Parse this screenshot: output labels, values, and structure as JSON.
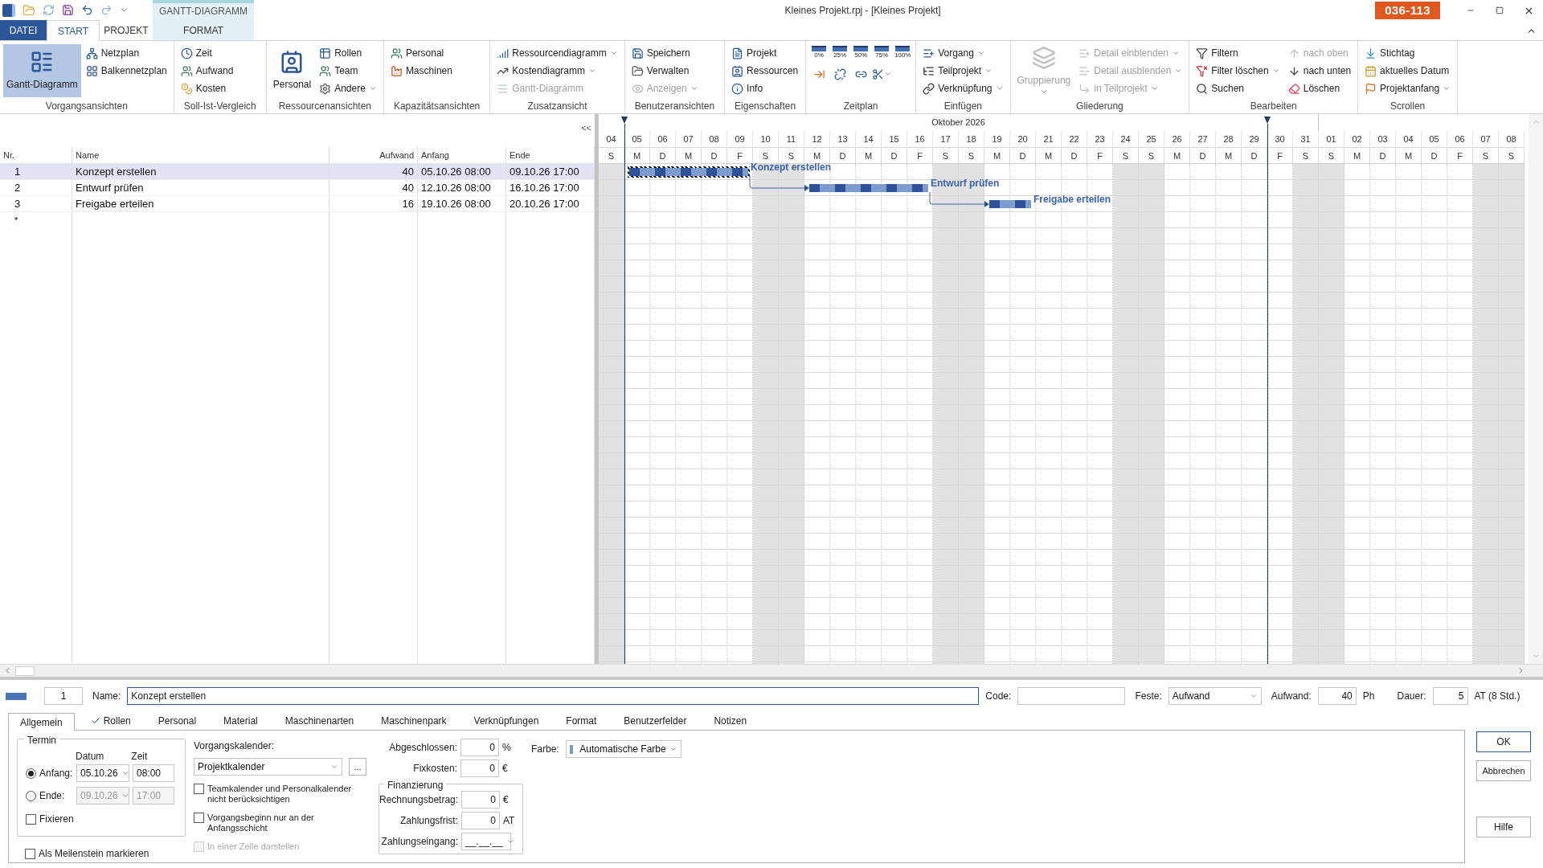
{
  "title_bar": {
    "title": "Kleines Projekt.rpj - [Kleines Projekt]",
    "badge": "036-113",
    "context_tab": "GANTT-DIAGRAMM"
  },
  "ribbon_tabs": [
    {
      "label": "DATEI",
      "kind": "file",
      "selected": false
    },
    {
      "label": "START",
      "kind": "tab",
      "selected": true
    },
    {
      "label": "PROJEKT",
      "kind": "tab",
      "selected": false
    },
    {
      "label": "FORMAT",
      "kind": "context",
      "selected": false
    }
  ],
  "ribbon_groups": [
    {
      "label": "Vorgangsansichten",
      "columns": [
        [
          {
            "label": "Gantt-Diagramm",
            "kind": "large",
            "selected": true,
            "disabled": false,
            "dropdown": false
          }
        ],
        [
          {
            "label": "Netzplan",
            "kind": "small",
            "selected": false,
            "disabled": false,
            "dropdown": false
          },
          {
            "label": "Balkennetzplan",
            "kind": "small",
            "selected": false,
            "disabled": false,
            "dropdown": false
          }
        ]
      ]
    },
    {
      "label": "Soll-Ist-Vergleich",
      "columns": [
        [
          {
            "label": "Zeit",
            "kind": "small",
            "disabled": false,
            "dropdown": false
          },
          {
            "label": "Aufwand",
            "kind": "small",
            "disabled": false,
            "dropdown": false
          },
          {
            "label": "Kosten",
            "kind": "small",
            "disabled": false,
            "dropdown": false
          }
        ]
      ]
    },
    {
      "label": "Ressourcenansichten",
      "columns": [
        [
          {
            "label": "Personal",
            "kind": "large",
            "disabled": false,
            "dropdown": false
          }
        ],
        [
          {
            "label": "Rollen",
            "kind": "small",
            "disabled": false,
            "dropdown": false
          },
          {
            "label": "Team",
            "kind": "small",
            "disabled": false,
            "dropdown": false
          },
          {
            "label": "Andere",
            "kind": "small",
            "disabled": false,
            "dropdown": true
          }
        ]
      ]
    },
    {
      "label": "Kapazitätsansichten",
      "columns": [
        [
          {
            "label": "Personal",
            "kind": "small",
            "disabled": false,
            "dropdown": false
          },
          {
            "label": "Maschinen",
            "kind": "small",
            "disabled": false,
            "dropdown": false
          }
        ]
      ]
    },
    {
      "label": "Zusatzansicht",
      "columns": [
        [
          {
            "label": "Ressourcendiagramm",
            "kind": "small",
            "disabled": false,
            "dropdown": true
          },
          {
            "label": "Kostendiagramm",
            "kind": "small",
            "disabled": false,
            "dropdown": true
          },
          {
            "label": "Gantt-Diagramm",
            "kind": "small",
            "disabled": true,
            "dropdown": false
          }
        ]
      ]
    },
    {
      "label": "Benutzeransichten",
      "columns": [
        [
          {
            "label": "Speichern",
            "kind": "small",
            "disabled": false,
            "dropdown": false
          },
          {
            "label": "Verwalten",
            "kind": "small",
            "disabled": false,
            "dropdown": false
          },
          {
            "label": "Anzeigen",
            "kind": "small",
            "disabled": true,
            "dropdown": true
          }
        ]
      ]
    },
    {
      "label": "Eigenschaften",
      "columns": [
        [
          {
            "label": "Projekt",
            "kind": "small",
            "disabled": false,
            "dropdown": false
          },
          {
            "label": "Ressourcen",
            "kind": "small",
            "disabled": false,
            "dropdown": false
          },
          {
            "label": "Info",
            "kind": "small",
            "disabled": false,
            "dropdown": false
          }
        ]
      ]
    },
    {
      "label": "Zeitplan",
      "columns": [
        [
          {
            "label": "0%",
            "kind": "percent",
            "disabled": false,
            "dropdown": false
          },
          {
            "kind": "icon",
            "disabled": false,
            "dropdown": false
          }
        ],
        [
          {
            "label": "25%",
            "kind": "percent",
            "disabled": false,
            "dropdown": false
          },
          {
            "kind": "icon",
            "disabled": false,
            "dropdown": false
          }
        ],
        [
          {
            "label": "50%",
            "kind": "percent",
            "disabled": false,
            "dropdown": false
          },
          {
            "kind": "icon",
            "disabled": false,
            "dropdown": false
          }
        ],
        [
          {
            "label": "75%",
            "kind": "percent",
            "disabled": false,
            "dropdown": false
          },
          {
            "kind": "icon",
            "disabled": false,
            "dropdown": true
          }
        ],
        [
          {
            "label": "100%",
            "kind": "percent",
            "disabled": false,
            "dropdown": false
          }
        ]
      ]
    },
    {
      "label": "Einfügen",
      "columns": [
        [
          {
            "label": "Vorgang",
            "kind": "small",
            "disabled": false,
            "dropdown": true
          },
          {
            "label": "Teilprojekt",
            "kind": "small",
            "disabled": false,
            "dropdown": true
          },
          {
            "label": "Verknüpfung",
            "kind": "small",
            "disabled": false,
            "dropdown": true
          }
        ]
      ]
    },
    {
      "label": "Gliederung",
      "columns": [
        [
          {
            "label": "Gruppierung",
            "kind": "large",
            "disabled": true,
            "dropdown": true
          }
        ],
        [
          {
            "label": "Detail einblenden",
            "kind": "small",
            "disabled": true,
            "dropdown": true
          },
          {
            "label": "Detail ausblenden",
            "kind": "small",
            "disabled": true,
            "dropdown": true
          },
          {
            "label": "in Teilprojekt",
            "kind": "small",
            "disabled": true,
            "dropdown": true
          }
        ]
      ]
    },
    {
      "label": "Bearbeiten",
      "columns": [
        [
          {
            "label": "Filtern",
            "kind": "small",
            "disabled": false,
            "dropdown": false
          },
          {
            "label": "Filter löschen",
            "kind": "small",
            "disabled": false,
            "dropdown": true
          },
          {
            "label": "Suchen",
            "kind": "small",
            "disabled": false,
            "dropdown": false
          }
        ],
        [
          {
            "label": "nach oben",
            "kind": "small",
            "disabled": true,
            "dropdown": false
          },
          {
            "label": "nach unten",
            "kind": "small",
            "disabled": false,
            "dropdown": false
          },
          {
            "label": "Löschen",
            "kind": "small",
            "disabled": false,
            "dropdown": false
          }
        ]
      ]
    },
    {
      "label": "Scrollen",
      "columns": [
        [
          {
            "label": "Stichtag",
            "kind": "small",
            "disabled": false,
            "dropdown": false
          },
          {
            "label": "aktuelles Datum",
            "kind": "small",
            "disabled": false,
            "dropdown": false
          },
          {
            "label": "Projektanfang",
            "kind": "small",
            "disabled": false,
            "dropdown": true
          }
        ]
      ]
    }
  ],
  "table": {
    "collapse_button": "<<",
    "columns": [
      "Nr.",
      "Name",
      "Aufwand",
      "Anfang",
      "Ende"
    ],
    "rows": [
      {
        "nr": "1",
        "name": "Konzept erstellen",
        "aufwand": "40",
        "anfang": "05.10.26 08:00",
        "ende": "09.10.26 17:00",
        "selected": true,
        "bar_label": "Konzept erstellen",
        "linked_from_previous": false
      },
      {
        "nr": "2",
        "name": "Entwurf prüfen",
        "aufwand": "40",
        "anfang": "12.10.26 08:00",
        "ende": "16.10.26 17:00",
        "selected": false,
        "bar_label": "Entwurf prüfen",
        "linked_from_previous": true
      },
      {
        "nr": "3",
        "name": "Freigabe erteilen",
        "aufwand": "16",
        "anfang": "19.10.26 08:00",
        "ende": "20.10.26 17:00",
        "selected": false,
        "bar_label": "Freigabe erteilen",
        "linked_from_previous": true
      }
    ],
    "new_row": "*"
  },
  "gantt": {
    "month": "Oktober 2026",
    "days": [
      {
        "day": "04",
        "weekday": "S",
        "weekend": true
      },
      {
        "day": "05",
        "weekday": "M",
        "weekend": false,
        "marker": true
      },
      {
        "day": "06",
        "weekday": "D",
        "weekend": false
      },
      {
        "day": "07",
        "weekday": "M",
        "weekend": false
      },
      {
        "day": "08",
        "weekday": "D",
        "weekend": false
      },
      {
        "day": "09",
        "weekday": "F",
        "weekend": false
      },
      {
        "day": "10",
        "weekday": "S",
        "weekend": true
      },
      {
        "day": "11",
        "weekday": "S",
        "weekend": true
      },
      {
        "day": "12",
        "weekday": "M",
        "weekend": false
      },
      {
        "day": "13",
        "weekday": "D",
        "weekend": false
      },
      {
        "day": "14",
        "weekday": "M",
        "weekend": false
      },
      {
        "day": "15",
        "weekday": "D",
        "weekend": false
      },
      {
        "day": "16",
        "weekday": "F",
        "weekend": false
      },
      {
        "day": "17",
        "weekday": "S",
        "weekend": true
      },
      {
        "day": "18",
        "weekday": "S",
        "weekend": true
      },
      {
        "day": "19",
        "weekday": "M",
        "weekend": false
      },
      {
        "day": "20",
        "weekday": "D",
        "weekend": false
      },
      {
        "day": "21",
        "weekday": "M",
        "weekend": false
      },
      {
        "day": "22",
        "weekday": "D",
        "weekend": false
      },
      {
        "day": "23",
        "weekday": "F",
        "weekend": false
      },
      {
        "day": "24",
        "weekday": "S",
        "weekend": true
      },
      {
        "day": "25",
        "weekday": "S",
        "weekend": true
      },
      {
        "day": "26",
        "weekday": "M",
        "weekend": false
      },
      {
        "day": "27",
        "weekday": "D",
        "weekend": false
      },
      {
        "day": "28",
        "weekday": "M",
        "weekend": false
      },
      {
        "day": "29",
        "weekday": "D",
        "weekend": false
      },
      {
        "day": "30",
        "weekday": "F",
        "weekend": false,
        "marker": true
      },
      {
        "day": "31",
        "weekday": "S",
        "weekend": true
      },
      {
        "day": "01",
        "weekday": "S",
        "weekend": true
      },
      {
        "day": "02",
        "weekday": "M",
        "weekend": false
      },
      {
        "day": "03",
        "weekday": "D",
        "weekend": false
      },
      {
        "day": "04",
        "weekday": "M",
        "weekend": false
      },
      {
        "day": "05",
        "weekday": "D",
        "weekend": false
      },
      {
        "day": "06",
        "weekday": "F",
        "weekend": false
      },
      {
        "day": "07",
        "weekday": "S",
        "weekend": true
      },
      {
        "day": "08",
        "weekday": "S",
        "weekend": true
      }
    ]
  },
  "task_form": {
    "number": "1",
    "name_label": "Name:",
    "name_value": "Konzept erstellen",
    "code_label": "Code:",
    "fixed_label": "Feste:",
    "fixed_value": "Aufwand",
    "effort_label": "Aufwand:",
    "effort_value": "40",
    "effort_unit": "Ph",
    "duration_label": "Dauer:",
    "duration_value": "5",
    "duration_unit": "AT (8 Std.)"
  },
  "form_tabs": [
    {
      "label": "Allgemein",
      "selected": true,
      "checked": false
    },
    {
      "label": "Rollen",
      "selected": false,
      "checked": true
    },
    {
      "label": "Personal",
      "selected": false,
      "checked": false
    },
    {
      "label": "Material",
      "selected": false,
      "checked": false
    },
    {
      "label": "Maschinenarten",
      "selected": false,
      "checked": false
    },
    {
      "label": "Maschinenpark",
      "selected": false,
      "checked": false
    },
    {
      "label": "Verknüpfungen",
      "selected": false,
      "checked": false
    },
    {
      "label": "Format",
      "selected": false,
      "checked": false
    },
    {
      "label": "Benutzerfelder",
      "selected": false,
      "checked": false
    },
    {
      "label": "Notizen",
      "selected": false,
      "checked": false
    }
  ],
  "general": {
    "termin": {
      "title": "Termin",
      "date_header": "Datum",
      "time_header": "Zeit",
      "rows": [
        {
          "label": "Anfang:",
          "selected": true,
          "date": "05.10.26",
          "time": "08:00",
          "disabled": false
        },
        {
          "label": "Ende:",
          "selected": false,
          "date": "09.10.26",
          "time": "17:00",
          "disabled": true
        }
      ],
      "fix": {
        "label": "Fixieren",
        "checked": false
      }
    },
    "milestone": {
      "label": "Als Meilenstein markieren",
      "checked": false
    },
    "calendar": {
      "label": "Vorgangskalender:",
      "value": "Projektkalender",
      "button": "..."
    },
    "options": [
      {
        "label": "Teamkalender und Personalkalender nicht berücksichtigen",
        "checked": false,
        "disabled": false
      },
      {
        "label": "Vorgangsbeginn nur an der Anfangsschicht",
        "checked": false,
        "disabled": false
      },
      {
        "label": "In einer Zelle darstellen",
        "checked": false,
        "disabled": true
      }
    ],
    "completed": {
      "label": "Abgeschlossen:",
      "value": "0",
      "unit": "%"
    },
    "fixed_costs": {
      "label": "Fixkosten:",
      "value": "0",
      "unit": "€"
    },
    "financing": {
      "title": "Finanzierung",
      "fields": [
        {
          "label": "Rechnungsbetrag:",
          "value": "0",
          "unit": "€",
          "kind": "number"
        },
        {
          "label": "Zahlungsfrist:",
          "value": "0",
          "unit": "AT",
          "kind": "number"
        },
        {
          "label": "Zahlungseingang:",
          "value": "__.__.__",
          "kind": "date"
        }
      ]
    },
    "color": {
      "label": "Farbe:",
      "value": "Automatische Farbe"
    }
  },
  "dialog_buttons": [
    {
      "label": "OK",
      "kind": "default"
    },
    {
      "label": "Abbrechen",
      "kind": "normal"
    },
    {
      "label": "Hilfe",
      "kind": "help"
    }
  ]
}
